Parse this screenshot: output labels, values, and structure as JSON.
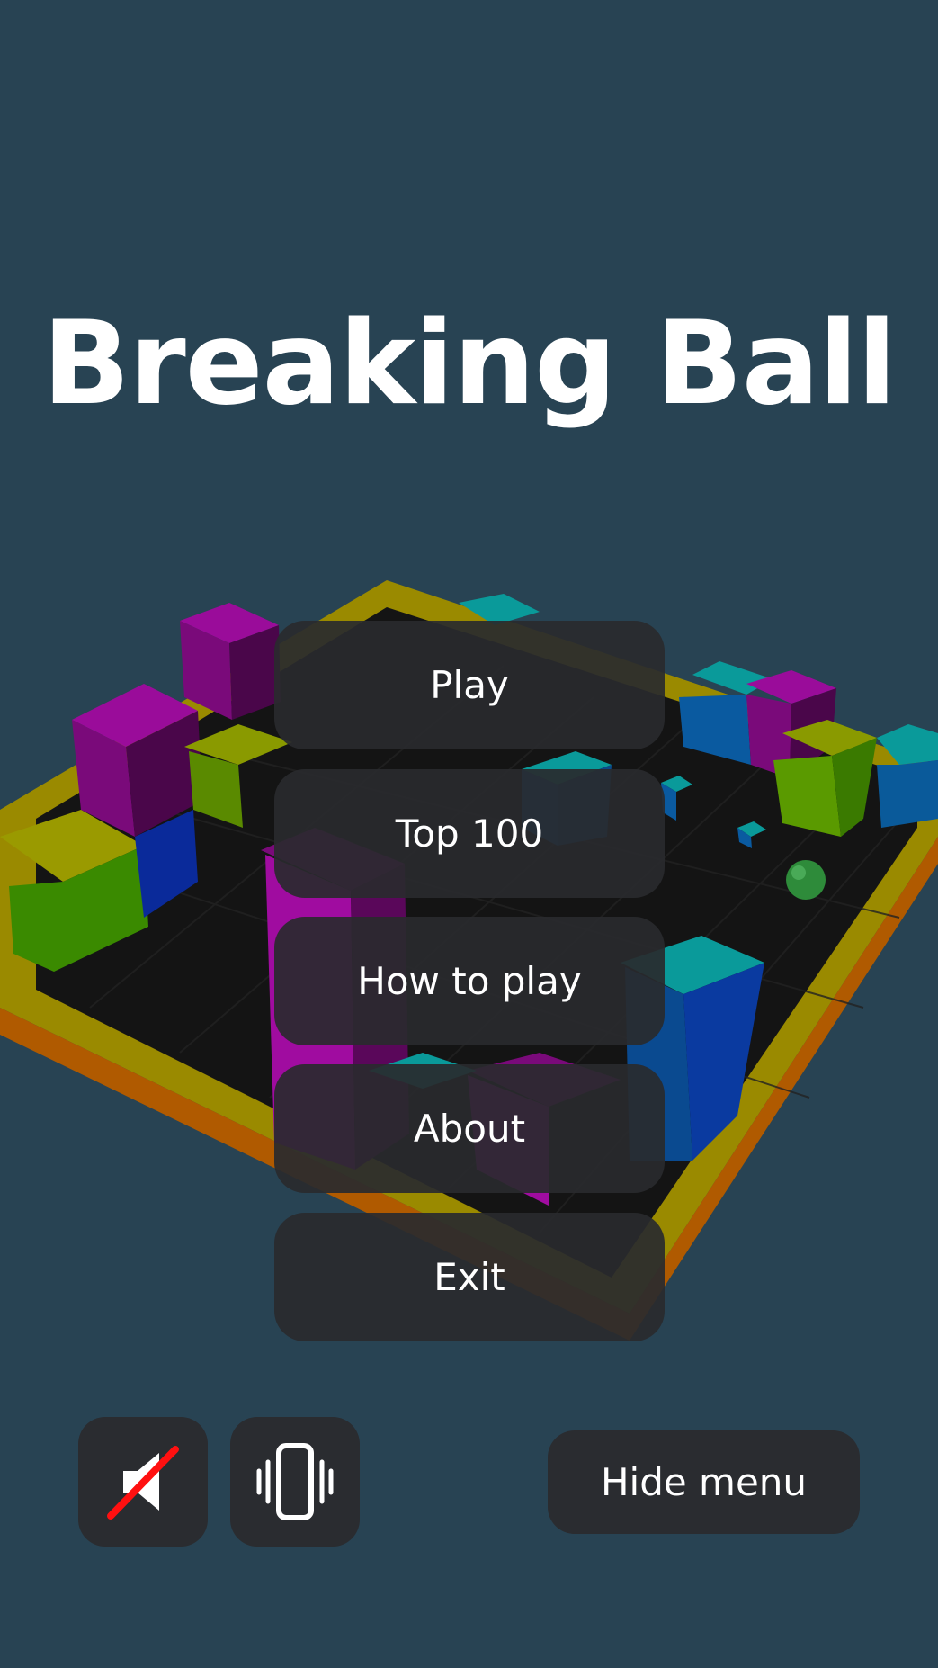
{
  "game": {
    "title": "Breaking Ball"
  },
  "menu": {
    "items": [
      {
        "label": "Play"
      },
      {
        "label": "Top 100"
      },
      {
        "label": "How to play"
      },
      {
        "label": "About"
      },
      {
        "label": "Exit"
      }
    ]
  },
  "controls": {
    "sound_icon": "speaker-muted-icon",
    "vibration_icon": "phone-vibrate-icon",
    "hide_menu_label": "Hide menu"
  },
  "colors": {
    "background": "#284353",
    "button_bg": "#2a2c30",
    "board_floor": "#141414",
    "board_frame": "#b59a00",
    "ball": "#2e8b3a",
    "block_magenta": "#8e0c8e",
    "block_cyan": "#0a8c8c",
    "block_green": "#5a8a00",
    "block_blue": "#0a4a9a"
  }
}
